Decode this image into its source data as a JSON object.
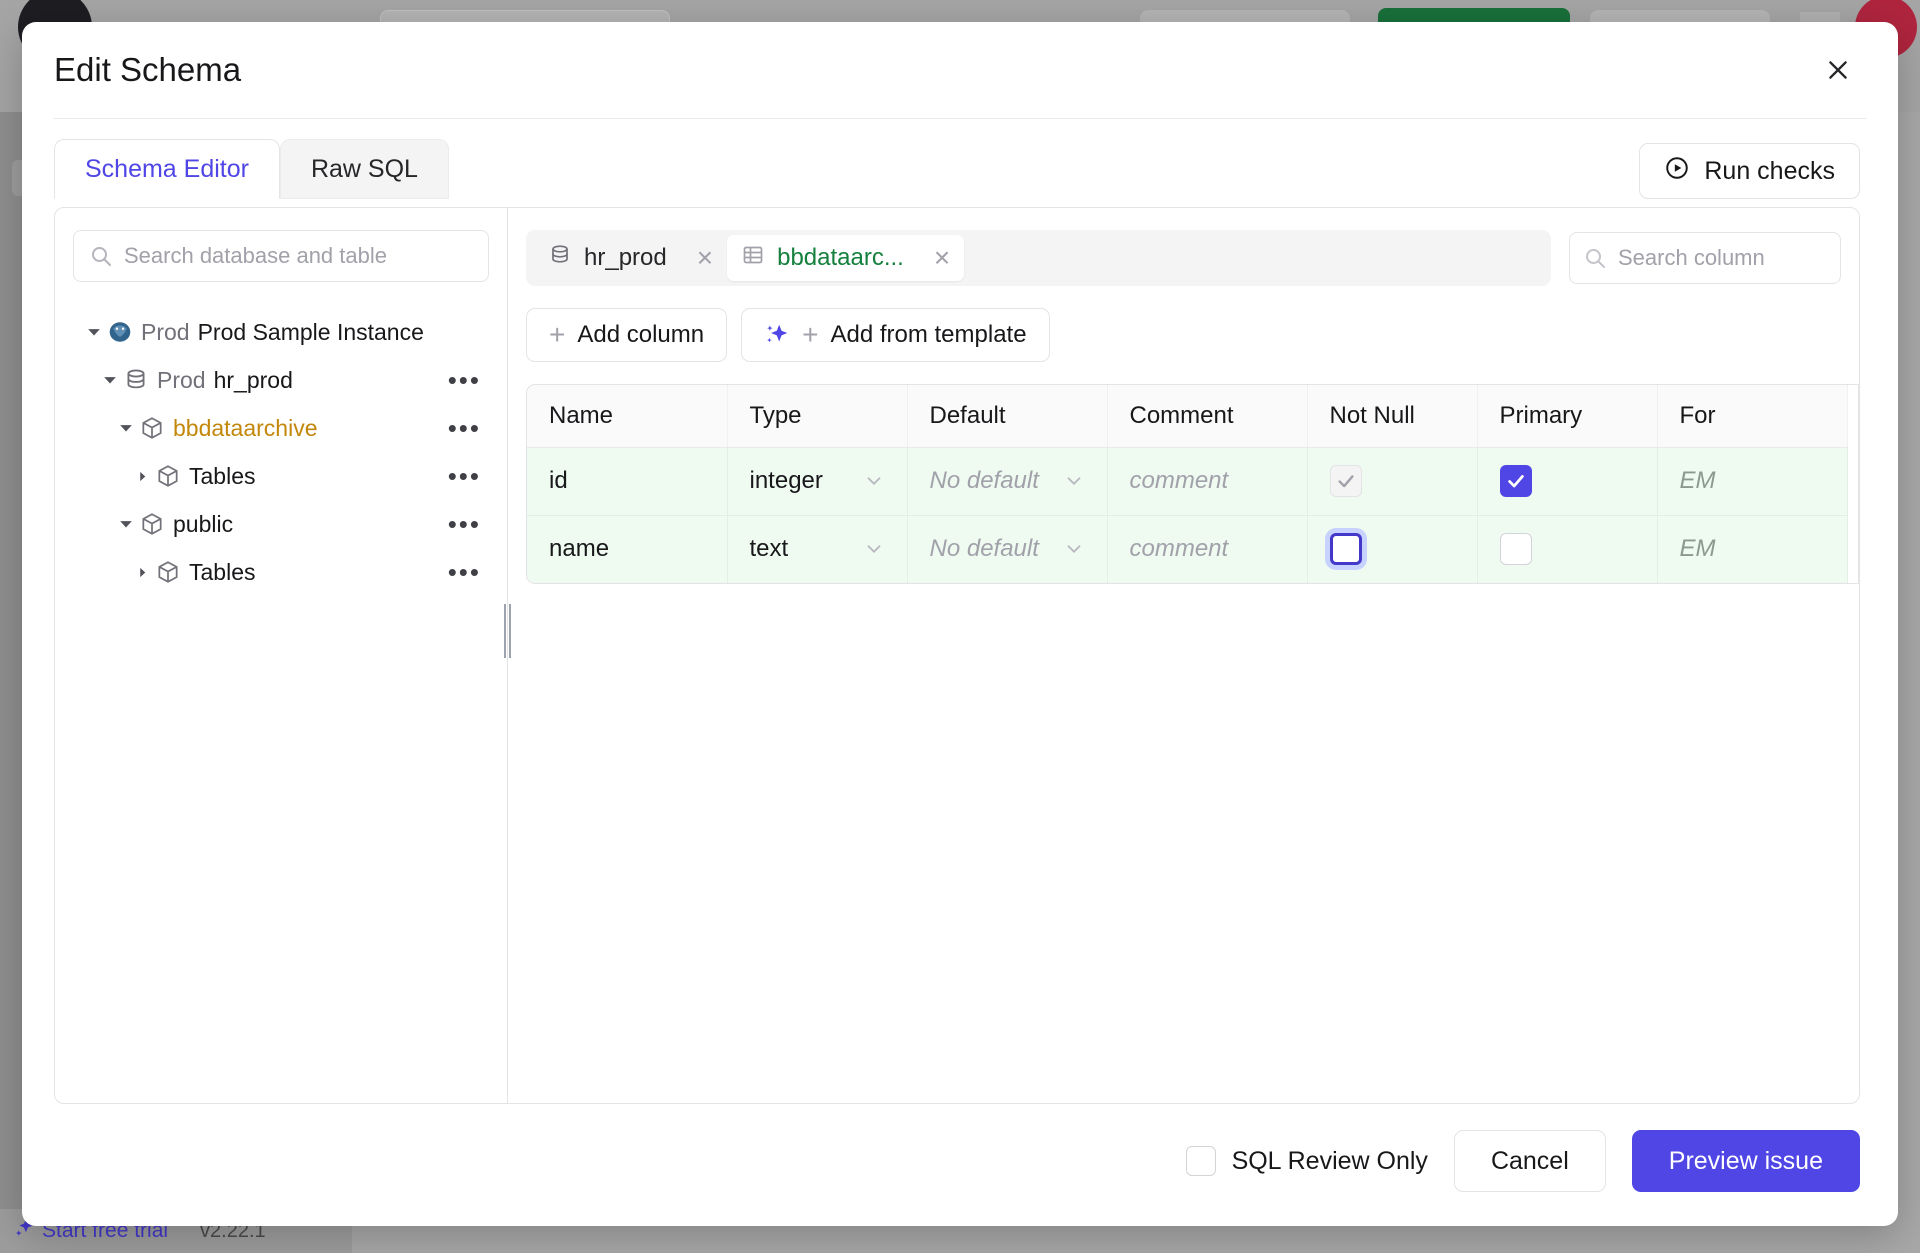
{
  "background": {
    "status_bar": {
      "trial_label": "Start free trial",
      "version": "v2.22.1"
    }
  },
  "modal": {
    "title": "Edit Schema",
    "close_icon": "close-icon",
    "tabs": [
      {
        "label": "Schema Editor",
        "active": true
      },
      {
        "label": "Raw SQL",
        "active": false
      }
    ],
    "run_checks_label": "Run checks",
    "run_checks_icon": "play-circle-icon"
  },
  "tree_pane": {
    "search": {
      "placeholder": "Search database and table",
      "value": "",
      "icon": "search-icon"
    },
    "nodes": [
      {
        "depth": 0,
        "caret": "down",
        "icon": "postgres-icon",
        "env": "Prod",
        "label": "Prod Sample Instance",
        "selected": false,
        "menu": false
      },
      {
        "depth": 1,
        "caret": "down",
        "icon": "database-icon",
        "env": "Prod",
        "label": "hr_prod",
        "selected": false,
        "menu": true
      },
      {
        "depth": 2,
        "caret": "down",
        "icon": "schema-icon",
        "env": "",
        "label": "bbdataarchive",
        "selected": true,
        "menu": true
      },
      {
        "depth": 3,
        "caret": "right",
        "icon": "schema-icon",
        "env": "",
        "label": "Tables",
        "selected": false,
        "menu": true
      },
      {
        "depth": 2,
        "caret": "down",
        "icon": "schema-icon",
        "env": "",
        "label": "public",
        "selected": false,
        "menu": true
      },
      {
        "depth": 3,
        "caret": "right",
        "icon": "schema-icon",
        "env": "",
        "label": "Tables",
        "selected": false,
        "menu": true
      }
    ],
    "menu_dots": "•••"
  },
  "content": {
    "chips": [
      {
        "label": "hr_prod",
        "icon": "database-icon",
        "kind": "db",
        "close": "×"
      },
      {
        "label": "bbdataarc...",
        "icon": "table-icon",
        "kind": "tbl",
        "close": "×"
      }
    ],
    "column_search": {
      "placeholder": "Search column",
      "value": "",
      "icon": "search-icon"
    },
    "actions": [
      {
        "label": "Add column",
        "icon": "plus-icon"
      },
      {
        "label": "Add from template",
        "icon": "sparkles-plus-icon"
      }
    ],
    "table": {
      "headers": [
        "Name",
        "Type",
        "Default",
        "Comment",
        "Not Null",
        "Primary",
        "For"
      ],
      "rows": [
        {
          "name": "id",
          "type": "integer",
          "default": "No default",
          "comment": "comment",
          "not_null": {
            "checked": true,
            "disabled": true,
            "focused": false
          },
          "primary": {
            "checked": true,
            "disabled": false,
            "focused": false
          },
          "foreign": "EM"
        },
        {
          "name": "name",
          "type": "text",
          "default": "No default",
          "comment": "comment",
          "not_null": {
            "checked": false,
            "disabled": false,
            "focused": true
          },
          "primary": {
            "checked": false,
            "disabled": false,
            "focused": false
          },
          "foreign": "EM"
        }
      ]
    }
  },
  "footer": {
    "sql_review_only_label": "SQL Review Only",
    "sql_review_only_checked": false,
    "cancel_label": "Cancel",
    "primary_label": "Preview issue"
  },
  "colors": {
    "accent": "#4f46e5",
    "selected_tree": "#c2870b",
    "table_chip": "#15803d",
    "row_tint": "#effaf1"
  }
}
